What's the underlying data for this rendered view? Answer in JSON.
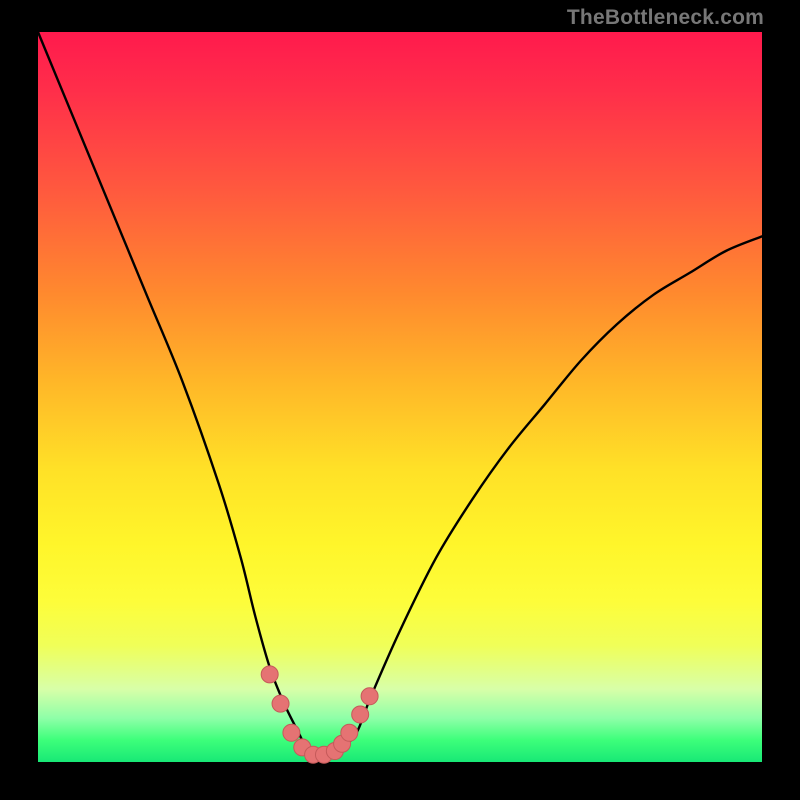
{
  "watermark": "TheBottleneck.com",
  "colors": {
    "background": "#000000",
    "curve": "#000000",
    "marker_fill": "#e57373",
    "marker_stroke": "#c55a5a"
  },
  "chart_data": {
    "type": "line",
    "title": "",
    "xlabel": "",
    "ylabel": "",
    "xlim": [
      0,
      100
    ],
    "ylim": [
      0,
      100
    ],
    "series": [
      {
        "name": "bottleneck-curve",
        "x": [
          0,
          5,
          10,
          15,
          20,
          25,
          28,
          30,
          32,
          34,
          36,
          37,
          38,
          40,
          42,
          44,
          46,
          50,
          55,
          60,
          65,
          70,
          75,
          80,
          85,
          90,
          95,
          100
        ],
        "y": [
          100,
          88,
          76,
          64,
          52,
          38,
          28,
          20,
          13,
          8,
          4,
          2,
          1,
          1,
          2,
          4,
          9,
          18,
          28,
          36,
          43,
          49,
          55,
          60,
          64,
          67,
          70,
          72
        ]
      }
    ],
    "markers": {
      "name": "highlighted-points",
      "x": [
        32,
        33.5,
        35,
        36.5,
        38,
        39.5,
        41,
        42,
        43,
        44.5,
        45.8
      ],
      "y": [
        12,
        8,
        4,
        2,
        1,
        1,
        1.5,
        2.5,
        4,
        6.5,
        9
      ]
    }
  }
}
